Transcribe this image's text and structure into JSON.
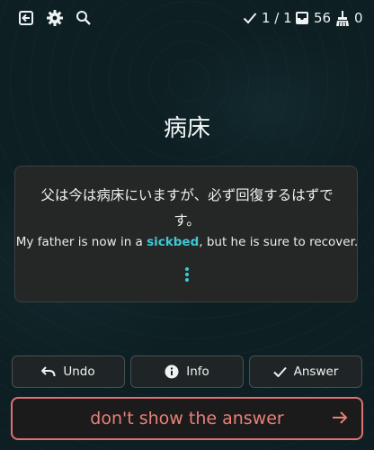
{
  "toolbar": {
    "exit_icon": "exit-icon",
    "settings_icon": "gear-icon",
    "search_icon": "search-icon"
  },
  "stats": {
    "progress": "1 / 1",
    "inbox_count": "56",
    "sweep_count": "0"
  },
  "card": {
    "word": "病床",
    "sentence_jp": "父は今は病床にいますが、必ず回復するはずです。",
    "sentence_en_before": "My father is now in a ",
    "sentence_en_highlight": "sickbed",
    "sentence_en_after": ", but he is sure to recover."
  },
  "actions": {
    "undo": "Undo",
    "info": "Info",
    "answer": "Answer",
    "dont_show": "don't show the answer"
  },
  "colors": {
    "accent": "#3ec9d6",
    "danger": "#e07070",
    "background": "#0d1f23"
  }
}
